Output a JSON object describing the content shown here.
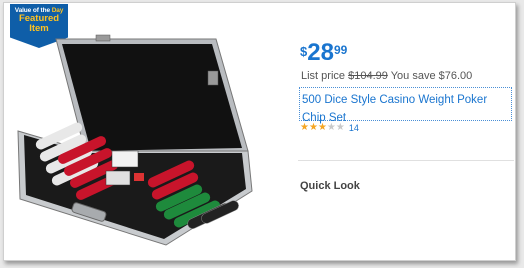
{
  "badge": {
    "top_prefix": "Value of the ",
    "top_highlight": "Day",
    "line1": "Featured",
    "line2": "Item"
  },
  "price": {
    "currency": "$",
    "whole": "28",
    "cents": "99"
  },
  "list_price": {
    "label": "List price",
    "value": "$104.99",
    "savings": "You save $76.00"
  },
  "product": {
    "title": "500 Dice Style Casino Weight Poker Chip Set",
    "image_alt": "poker-chip-set-in-aluminum-case"
  },
  "rating": {
    "stars": 3,
    "max_stars": 5,
    "review_count": "14",
    "star_color": "#f5a623"
  },
  "actions": {
    "quick_look": "Quick Look"
  },
  "colors": {
    "accent": "#1a75cf",
    "badge_bg": "#0f5ea8",
    "badge_text": "#ffc220"
  }
}
